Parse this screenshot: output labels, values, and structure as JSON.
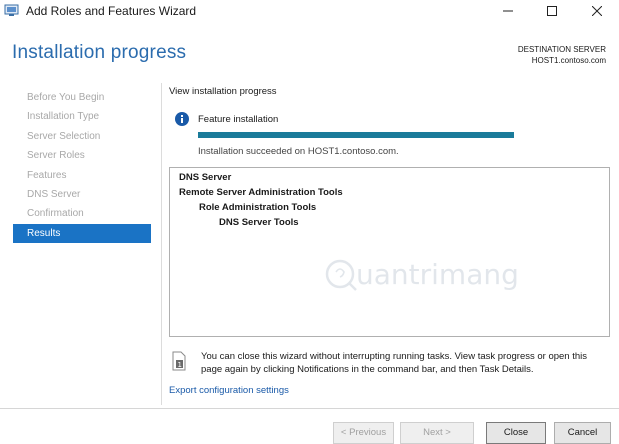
{
  "window": {
    "title": "Add Roles and Features Wizard",
    "controls": {
      "minimize": "minimize-icon",
      "maximize": "maximize-icon",
      "close": "close-icon"
    }
  },
  "header": {
    "page_title": "Installation progress",
    "destination_label": "DESTINATION SERVER",
    "destination_host": "HOST1.contoso.com"
  },
  "sidebar": {
    "items": [
      {
        "label": "Before You Begin",
        "active": false
      },
      {
        "label": "Installation Type",
        "active": false
      },
      {
        "label": "Server Selection",
        "active": false
      },
      {
        "label": "Server Roles",
        "active": false
      },
      {
        "label": "Features",
        "active": false
      },
      {
        "label": "DNS Server",
        "active": false
      },
      {
        "label": "Confirmation",
        "active": false
      },
      {
        "label": "Results",
        "active": true
      }
    ]
  },
  "main": {
    "view_label": "View installation progress",
    "feature_label": "Feature installation",
    "progress_fraction": 1.0,
    "status_text": "Installation succeeded on HOST1.contoso.com.",
    "results": [
      {
        "text": "DNS Server",
        "level": 0
      },
      {
        "text": "Remote Server Administration Tools",
        "level": 0
      },
      {
        "text": "Role Administration Tools",
        "level": 1
      },
      {
        "text": "DNS Server Tools",
        "level": 2
      }
    ],
    "note": "You can close this wizard without interrupting running tasks. View task progress or open this page again by clicking Notifications in the command bar, and then Task Details.",
    "export_link": "Export configuration settings"
  },
  "footer": {
    "previous": "< Previous",
    "next": "Next >",
    "close": "Close",
    "cancel": "Cancel"
  },
  "colors": {
    "accent": "#1a73c5",
    "title": "#2b6cae",
    "progress": "#1a7b9a",
    "info": "#1a5aa8"
  },
  "watermark": "Quantrimang"
}
